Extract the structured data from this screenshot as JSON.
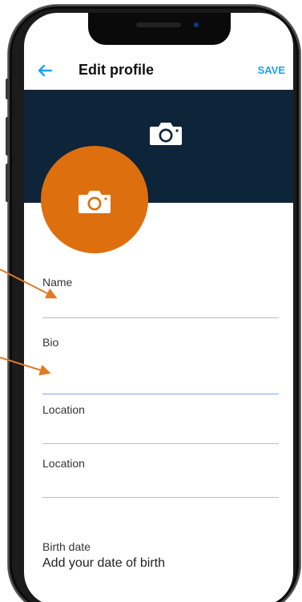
{
  "appbar": {
    "title": "Edit profile",
    "save_label": "SAVE",
    "back_icon": "arrow-left-icon"
  },
  "colors": {
    "banner": "#0e2439",
    "avatar": "#de6f0e",
    "accent": "#1da1f2",
    "annotation": "#e07a24"
  },
  "banner": {
    "icon": "camera-icon"
  },
  "avatar": {
    "icon": "camera-icon"
  },
  "form": {
    "fields": [
      {
        "label": "Name",
        "value": ""
      },
      {
        "label": "Bio",
        "value": ""
      },
      {
        "label": "Location",
        "value": ""
      },
      {
        "label": "Location",
        "value": ""
      }
    ],
    "birth_date": {
      "label": "Birth date",
      "value": "Add your date of birth"
    }
  }
}
